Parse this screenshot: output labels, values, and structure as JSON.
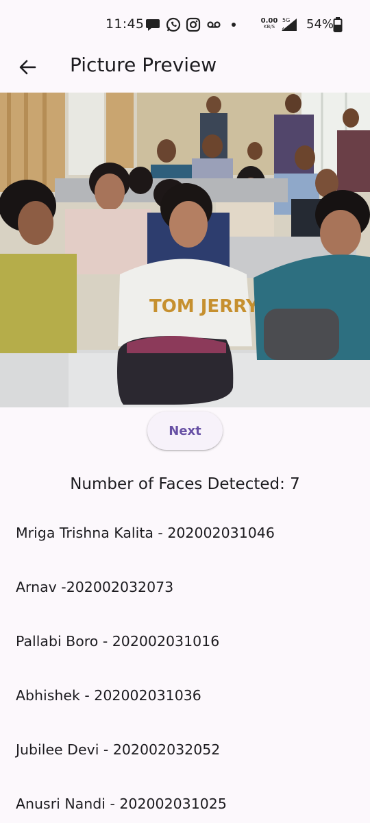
{
  "status_bar": {
    "time": "11:45",
    "net_speed_value": "0.00",
    "net_speed_unit": "KB/S",
    "network_type": "5G",
    "battery_percent": "54%",
    "notification_icons": [
      "chat-icon",
      "whatsapp-icon",
      "instagram-icon",
      "voicemail-icon",
      "dot-icon"
    ]
  },
  "app_bar": {
    "title": "Picture Preview"
  },
  "actions": {
    "next_label": "Next"
  },
  "faces": {
    "summary": "Number of Faces Detected: 7"
  },
  "students": [
    "Mriga Trishna Kalita - 202002031046",
    "Arnav -202002032073",
    "Pallabi Boro - 202002031016",
    "Abhishek - 202002031036",
    "Jubilee Devi - 202002032052",
    "Anusri Nandi - 202002031025"
  ],
  "colors": {
    "background": "#FCF8FC",
    "accent": "#6750A4"
  }
}
